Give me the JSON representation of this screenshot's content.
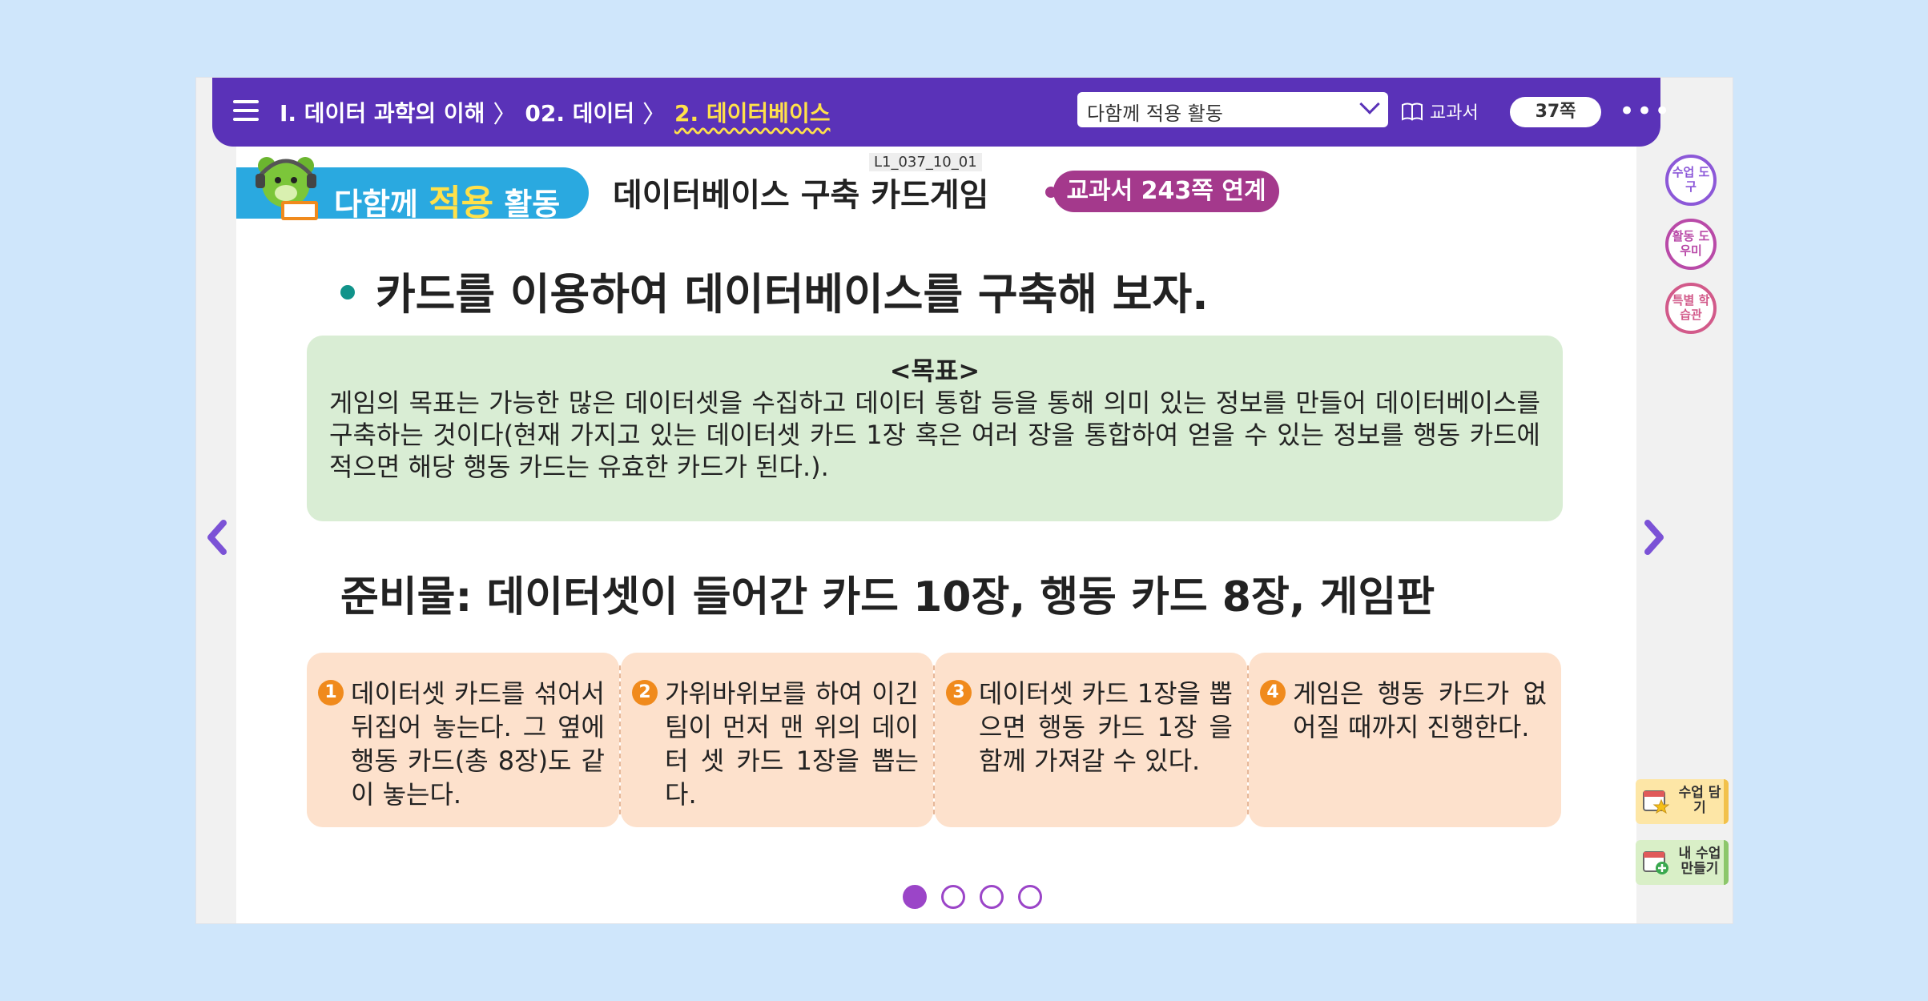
{
  "breadcrumb": {
    "items": [
      "Ⅰ. 데이터 과학의 이해",
      "02. 데이터",
      "2. 데이터베이스"
    ]
  },
  "header": {
    "activity_select_value": "다함께 적용 활동",
    "textbook_label": "교과서",
    "page_indicator": "37쪽"
  },
  "activity": {
    "badge_prefix": "다함께",
    "badge_emphasis": "적용",
    "badge_suffix": "활동",
    "code": "L1_037_10_01",
    "title": "데이터베이스 구축 카드게임",
    "link_badge": "교과서 243쪽 연계"
  },
  "main": {
    "goal_sentence": "카드를 이용하여 데이터베이스를 구축해 보자.",
    "goal_box": {
      "heading": "<목표>",
      "body": "게임의 목표는 가능한 많은 데이터셋을 수집하고 데이터 통합 등을 통해 의미 있는 정보를 만들어 데이터베이스를 구축하는 것이다(현재 가지고 있는 데이터셋 카드 1장 혹은 여러 장을 통합하여 얻을 수 있는 정보를 행동 카드에 적으면 해당 행동 카드는 유효한 카드가 된다.)."
    },
    "materials": "준비물: 데이터셋이 들어간 카드 10장, 행동 카드 8장, 게임판",
    "steps": [
      {
        "num": "1",
        "text": "데이터셋 카드를 섞어서 뒤집어 놓는다. 그 옆에 행동 카드(총 8장)도 같이 놓는다."
      },
      {
        "num": "2",
        "text": "가위바위보를 하여 이긴 팀이 먼저 맨 위의 데이터 셋 카드 1장을 뽑는다."
      },
      {
        "num": "3",
        "text": "데이터셋 카드 1장을 뽑으면 행동 카드 1장 을 함께 가져갈 수 있다."
      },
      {
        "num": "4",
        "text": "게임은 행동 카드가 없어질 때까지 진행한다."
      }
    ],
    "pager": {
      "total": 4,
      "current": 1
    }
  },
  "side_tools": {
    "lesson_tools": "수업 도구",
    "activity_helper": "활동 도우미",
    "special_hall": "특별 학습관",
    "save_lesson": "수업 담기",
    "make_lesson": "내 수업 만들기"
  },
  "colors": {
    "header_purple": "#5a32b8",
    "highlight_yellow": "#ffe14a",
    "badge_blue": "#2aa9e0",
    "link_magenta": "#a4398c",
    "goal_green": "#d9edd4",
    "step_peach": "#fde1cc",
    "step_orange": "#f08a1c",
    "pager_purple": "#9b45c8"
  }
}
